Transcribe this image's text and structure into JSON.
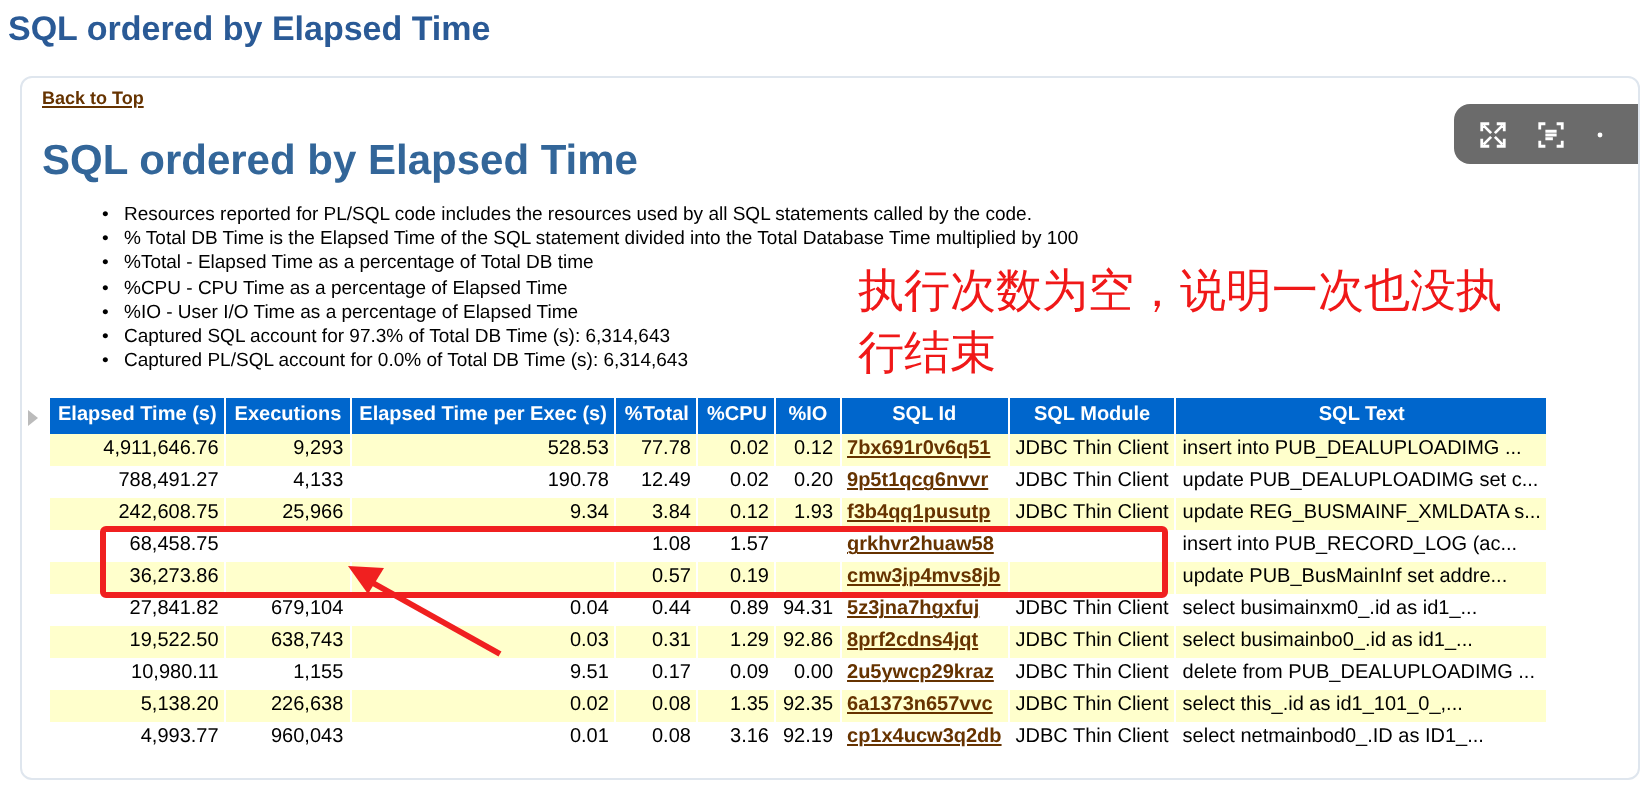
{
  "page_title": "SQL ordered by Elapsed Time",
  "back_link": "Back to Top",
  "report_title": "SQL ordered by Elapsed Time",
  "notes": [
    {
      "bullet": "•",
      "text": "Resources reported for PL/SQL code includes the resources used by all SQL statements called by the code."
    },
    {
      "bullet": "•",
      "text": "% Total DB Time is the Elapsed Time of the SQL statement divided into the Total Database Time multiplied by 100"
    },
    {
      "bullet": "•",
      "text": "%Total - Elapsed Time as a percentage of Total DB time"
    },
    {
      "bullet": "•",
      "text": "%CPU - CPU Time as a percentage of Elapsed Time"
    },
    {
      "bullet": "•",
      "text": "%IO - User I/O Time as a percentage of Elapsed Time"
    },
    {
      "bullet": "•",
      "text": "Captured SQL account for 97.3% of Total DB Time (s): 6,314,643"
    },
    {
      "bullet": "•",
      "text": "Captured PL/SQL account for 0.0% of Total DB Time (s): 6,314,643"
    }
  ],
  "annotation": "执行次数为空，说明一次也没执行结束",
  "table": {
    "columns": [
      "Elapsed Time (s)",
      "Executions",
      "Elapsed Time per Exec (s)",
      "%Total",
      "%CPU",
      "%IO",
      "SQL Id",
      "SQL Module",
      "SQL Text"
    ],
    "rows": [
      [
        "4,911,646.76",
        "9,293",
        "528.53",
        "77.78",
        "0.02",
        "0.12",
        "7bx691r0v6q51",
        "JDBC Thin Client",
        "insert into PUB_DEALUPLOADIMG ..."
      ],
      [
        "788,491.27",
        "4,133",
        "190.78",
        "12.49",
        "0.02",
        "0.20",
        "9p5t1qcg6nvvr",
        "JDBC Thin Client",
        "update PUB_DEALUPLOADIMG set c..."
      ],
      [
        "242,608.75",
        "25,966",
        "9.34",
        "3.84",
        "0.12",
        "1.93",
        "f3b4qq1pusutp",
        "JDBC Thin Client",
        "update REG_BUSMAINF_XMLDATA s..."
      ],
      [
        "68,458.75",
        "",
        "",
        "1.08",
        "1.57",
        "",
        "grkhvr2huaw58",
        "",
        "insert into PUB_RECORD_LOG (ac..."
      ],
      [
        "36,273.86",
        "",
        "",
        "0.57",
        "0.19",
        "",
        "cmw3jp4mvs8jb",
        "",
        "update PUB_BusMainInf set addre..."
      ],
      [
        "27,841.82",
        "679,104",
        "0.04",
        "0.44",
        "0.89",
        "94.31",
        "5z3jna7hgxfuj",
        "JDBC Thin Client",
        "select busimainxm0_.id as id1_..."
      ],
      [
        "19,522.50",
        "638,743",
        "0.03",
        "0.31",
        "1.29",
        "92.86",
        "8prf2cdns4jqt",
        "JDBC Thin Client",
        "select busimainbo0_.id as id1_..."
      ],
      [
        "10,980.11",
        "1,155",
        "9.51",
        "0.17",
        "0.09",
        "0.00",
        "2u5ywcp29kraz",
        "JDBC Thin Client",
        "delete from PUB_DEALUPLOADIMG ..."
      ],
      [
        "5,138.20",
        "226,638",
        "0.02",
        "0.08",
        "1.35",
        "92.35",
        "6a1373n657vvc",
        "JDBC Thin Client",
        "select this_.id as id1_101_0_,..."
      ],
      [
        "4,993.77",
        "960,043",
        "0.01",
        "0.08",
        "3.16",
        "92.19",
        "cp1x4ucw3q2db",
        "JDBC Thin Client",
        "select netmainbod0_.ID as ID1_..."
      ]
    ]
  }
}
